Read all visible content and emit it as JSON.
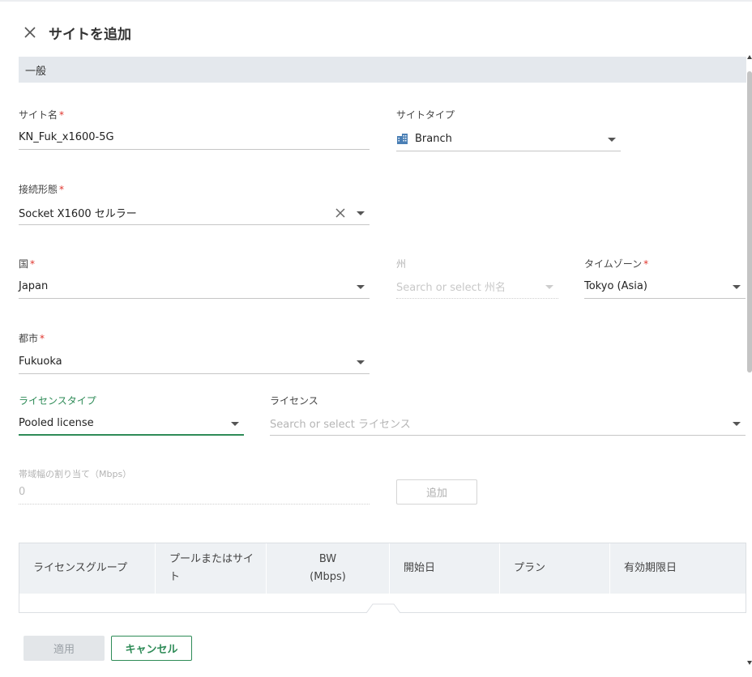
{
  "dialog": {
    "title": "サイトを追加"
  },
  "section": {
    "general": "一般"
  },
  "fields": {
    "site_name": {
      "label": "サイト名",
      "required": "*",
      "value": "KN_Fuk_x1600-5G"
    },
    "site_type": {
      "label": "サイトタイプ",
      "value": "Branch",
      "icon": "building-icon"
    },
    "connection_type": {
      "label": "接続形態",
      "required": "*",
      "value": "Socket X1600 セルラー"
    },
    "country": {
      "label": "国",
      "required": "*",
      "value": "Japan"
    },
    "state": {
      "label": "州",
      "placeholder": "Search or select 州名"
    },
    "timezone": {
      "label": "タイムゾーン",
      "required": "*",
      "value": "Tokyo (Asia)"
    },
    "city": {
      "label": "都市",
      "required": "*",
      "value": "Fukuoka"
    },
    "license_type": {
      "label": "ライセンスタイプ",
      "value": "Pooled license"
    },
    "license": {
      "label": "ライセンス",
      "placeholder": "Search or select ライセンス"
    },
    "bandwidth": {
      "label": "帯域幅の割り当て（Mbps）",
      "value": "0"
    }
  },
  "buttons": {
    "add": "追加",
    "apply": "適用",
    "cancel": "キャンセル"
  },
  "table": {
    "headers": [
      "ライセンスグループ",
      "プールまたはサイト",
      "BW\n(Mbps)",
      "開始日",
      "プラン",
      "有効期限日"
    ]
  },
  "colors": {
    "accent": "#2e8b57",
    "required": "#e0342c",
    "section_bg": "#e4e8ed"
  }
}
